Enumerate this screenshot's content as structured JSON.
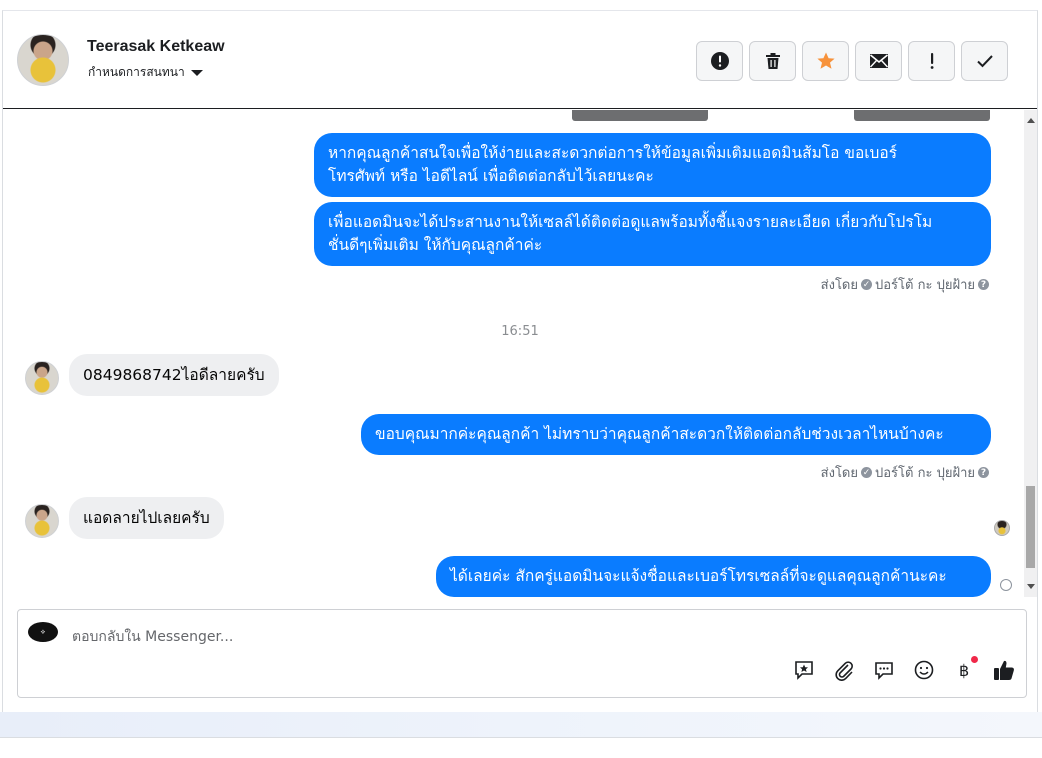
{
  "header": {
    "name": "Teerasak Ketkeaw",
    "subtitle": "กำหนดการสนทนา",
    "buttons": [
      {
        "name": "report-button",
        "icon": "alert-circle-icon"
      },
      {
        "name": "delete-button",
        "icon": "trash-icon"
      },
      {
        "name": "star-button",
        "icon": "star-icon",
        "color": "#f7923b"
      },
      {
        "name": "mark-unread-button",
        "icon": "envelope-icon"
      },
      {
        "name": "spam-button",
        "icon": "exclamation-icon"
      },
      {
        "name": "done-button",
        "icon": "check-icon"
      }
    ]
  },
  "messages": [
    {
      "from": "page",
      "text": "หากคุณลูกค้าสนใจเพื่อให้ง่ายและสะดวกต่อการให้ข้อมูลเพิ่มเติมแอดมินส้มโอ ขอเบอร์\nโทรศัพท์ หรือ ไอดีไลน์ เพื่อติดต่อกลับไว้เลยนะคะ"
    },
    {
      "from": "page",
      "text": "เพื่อแอดมินจะได้ประสานงานให้เซลล์ได้ติดต่อดูแลพร้อมทั้งชี้แจงรายละเอียด เกี่ยวกับโปรโม\nชั่นดีๆเพิ่มเติม ให้กับคุณลูกค้าค่ะ"
    },
    {
      "from": "user",
      "text": "0849868742ไอดีลายครับ"
    },
    {
      "from": "page",
      "text": "ขอบคุณมากค่ะคุณลูกค้า ไม่ทราบว่าคุณลูกค้าสะดวกให้ติดต่อกลับช่วงเวลาไหนบ้างคะ"
    },
    {
      "from": "user",
      "text": "แอดลายไปเลยครับ"
    },
    {
      "from": "page",
      "text": "ได้เลยค่ะ สักครู่แอดมินจะแจ้งชื่อและเบอร์โทรเซลล์ที่จะดูแลคุณลูกค้านะคะ"
    }
  ],
  "sent_by": {
    "prefix": "ส่งโดย",
    "name": "ปอร์โต้ กะ ปุยฝ้าย"
  },
  "timestamp": "16:51",
  "composer": {
    "placeholder": "ตอบกลับใน Messenger...",
    "icons": [
      "saved-reply-icon",
      "attachment-icon",
      "comment-icon",
      "emoji-icon",
      "baht-icon",
      "thumbs-up-icon"
    ]
  },
  "colors": {
    "outgoing_bubble": "#0a7cff",
    "incoming_bubble": "#eeeff1",
    "star": "#f7923b"
  }
}
